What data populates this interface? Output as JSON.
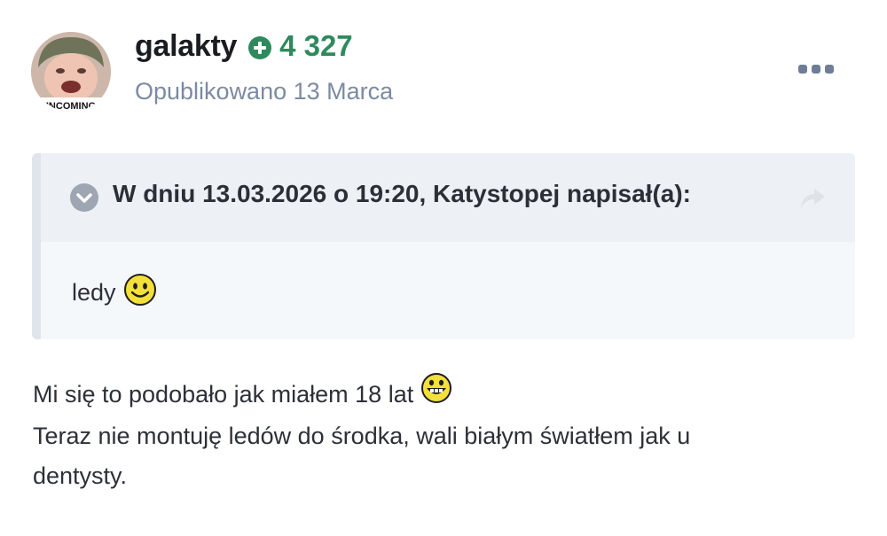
{
  "author": {
    "name": "galakty",
    "reputation": "4 327",
    "avatar_caption": "INCOMING"
  },
  "post": {
    "date_text": "Opublikowano 13 Marca"
  },
  "quote": {
    "citation": "W dniu 13.03.2026 o 19:20, Katystopej napisał(a):",
    "text": "ledy"
  },
  "body": {
    "line1": "Mi się to podobało jak miałem 18 lat",
    "line2": "Teraz nie montuję ledów do środka, wali białym światłem jak u",
    "line3": "dentysty."
  },
  "icons": {
    "reputation": "plus-circle-icon",
    "more": "ellipsis-icon",
    "toggle": "chevron-down-circle-icon",
    "share": "share-arrow-icon",
    "emoticon_quote": "smile-emoticon",
    "emoticon_body": "grin-emoticon"
  },
  "colors": {
    "reputation_green": "#2e8a5c",
    "date_gray": "#7c8aa3",
    "quote_background": "#f1f4f8"
  }
}
